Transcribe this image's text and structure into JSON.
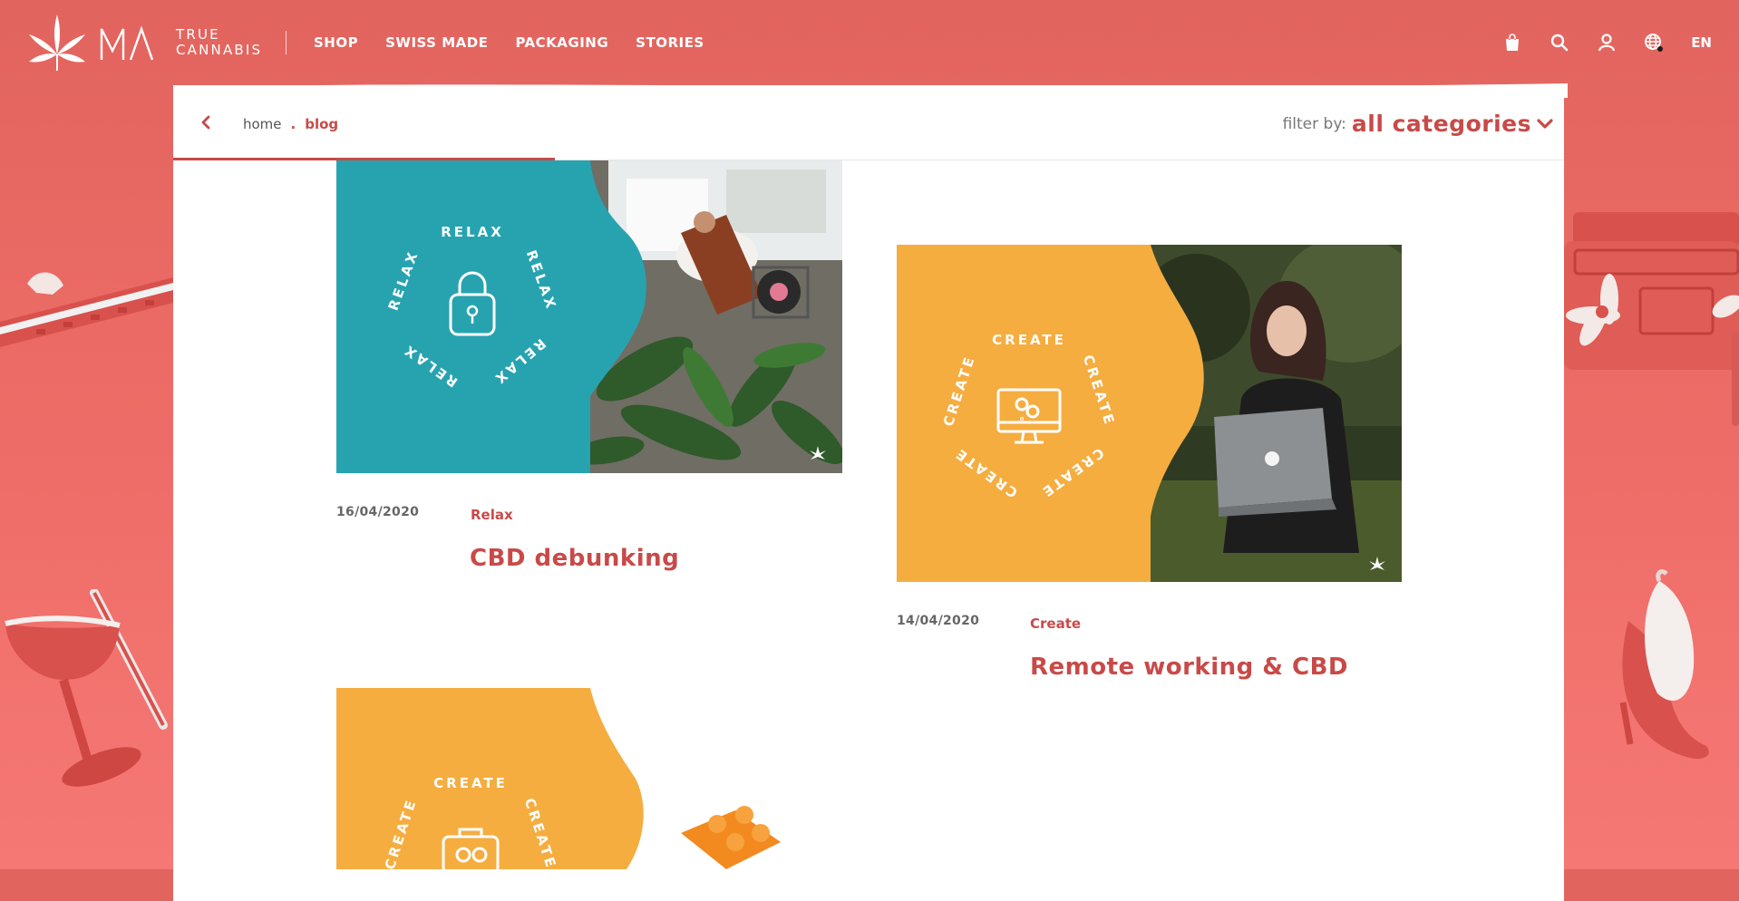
{
  "brand": {
    "line1": "TRUE",
    "line2": "CANNABIS"
  },
  "nav": {
    "items": [
      "SHOP",
      "SWISS MADE",
      "PACKAGING",
      "STORIES"
    ]
  },
  "tools": {
    "language": "EN"
  },
  "breadcrumb": {
    "home": "home",
    "separator": ".",
    "current": "blog"
  },
  "filter": {
    "label": "filter by:",
    "value": "all categories"
  },
  "posts": [
    {
      "date": "16/04/2020",
      "category": "Relax",
      "title": "CBD debunking",
      "badge_word": "RELAX",
      "panel_color": "#27a3b0"
    },
    {
      "date": "14/04/2020",
      "category": "Create",
      "title": "Remote working & CBD",
      "badge_word": "CREATE",
      "panel_color": "#f5ad40"
    },
    {
      "badge_word": "CREATE",
      "panel_color": "#f5ad40"
    }
  ],
  "colors": {
    "background": "#e8655f",
    "accent": "#c84a48",
    "paper": "#ffffff"
  }
}
